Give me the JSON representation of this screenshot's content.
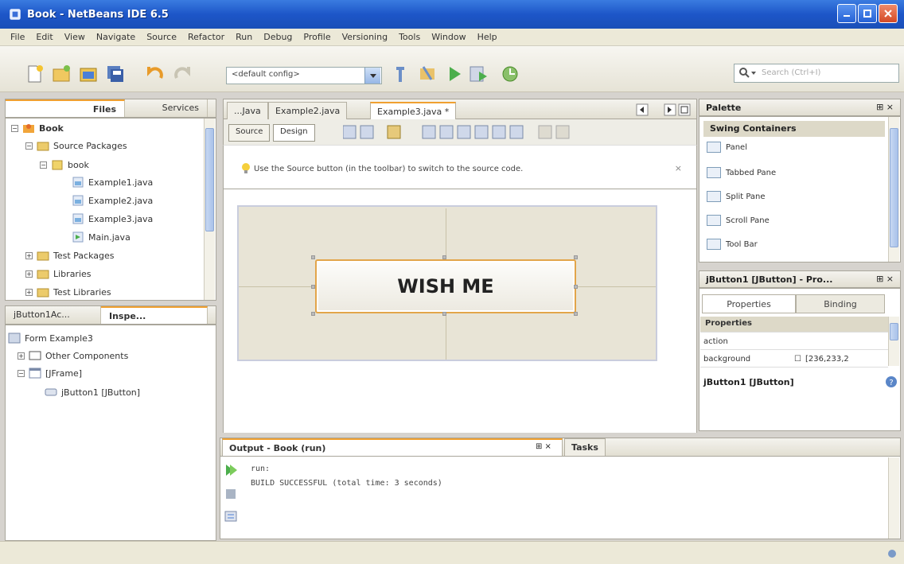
{
  "window": {
    "title": "Book - NetBeans IDE 6.5"
  },
  "menu": [
    "File",
    "Edit",
    "View",
    "Navigate",
    "Source",
    "Refactor",
    "Run",
    "Debug",
    "Profile",
    "Versioning",
    "Tools",
    "Window",
    "Help"
  ],
  "toolbar": {
    "config_value": "<default config>",
    "search_placeholder": "Search (Ctrl+I)"
  },
  "projects_panel": {
    "tabs": [
      "Files",
      "Services"
    ],
    "tree": [
      {
        "label": "Book",
        "level": 0,
        "icon": "project-icon"
      },
      {
        "label": "Source Packages",
        "level": 1,
        "icon": "folder-icon"
      },
      {
        "label": "book",
        "level": 2,
        "icon": "package-icon"
      },
      {
        "label": "Example1.java",
        "level": 3,
        "icon": "java-file-icon"
      },
      {
        "label": "Example2.java",
        "level": 3,
        "icon": "java-file-icon"
      },
      {
        "label": "Example3.java",
        "level": 3,
        "icon": "java-file-icon"
      },
      {
        "label": "Main.java",
        "level": 3,
        "icon": "java-main-icon"
      },
      {
        "label": "Test Packages",
        "level": 1,
        "icon": "folder-icon"
      },
      {
        "label": "Libraries",
        "level": 1,
        "icon": "folder-icon"
      },
      {
        "label": "Test Libraries",
        "level": 1,
        "icon": "folder-icon"
      }
    ]
  },
  "inspector_panel": {
    "tabs": [
      "jButton1Ac...",
      "Inspe..."
    ],
    "tree": [
      {
        "label": "Form Example3",
        "level": 0
      },
      {
        "label": "Other Components",
        "level": 1
      },
      {
        "label": "[JFrame]",
        "level": 1
      },
      {
        "label": "jButton1 [JButton]",
        "level": 2
      }
    ]
  },
  "editor": {
    "tabs": [
      "...Java",
      "Example2.java",
      "Example3.java *"
    ],
    "modes": [
      "Source",
      "Design"
    ],
    "hint": "Use the Source button (in the toolbar) to switch to the source code.",
    "hint_close": "×",
    "form_button_label": "WISH ME"
  },
  "palette": {
    "title": "Palette",
    "category": "Swing Containers",
    "items": [
      "Panel",
      "Tabbed Pane",
      "Split Pane",
      "Scroll Pane",
      "Tool Bar"
    ]
  },
  "properties": {
    "title": "jButton1 [JButton] - Pro...",
    "tabs": [
      "Properties",
      "Binding"
    ],
    "section": "Properties",
    "rows": [
      {
        "name": "action",
        "value": ""
      },
      {
        "name": "background",
        "value": "[236,233,2"
      }
    ],
    "footer": "jButton1 [JButton]"
  },
  "output": {
    "tabs": [
      "Output - Book (run)",
      "Tasks"
    ],
    "lines": [
      "run:",
      "BUILD SUCCESSFUL (total time: 3 seconds)"
    ]
  }
}
